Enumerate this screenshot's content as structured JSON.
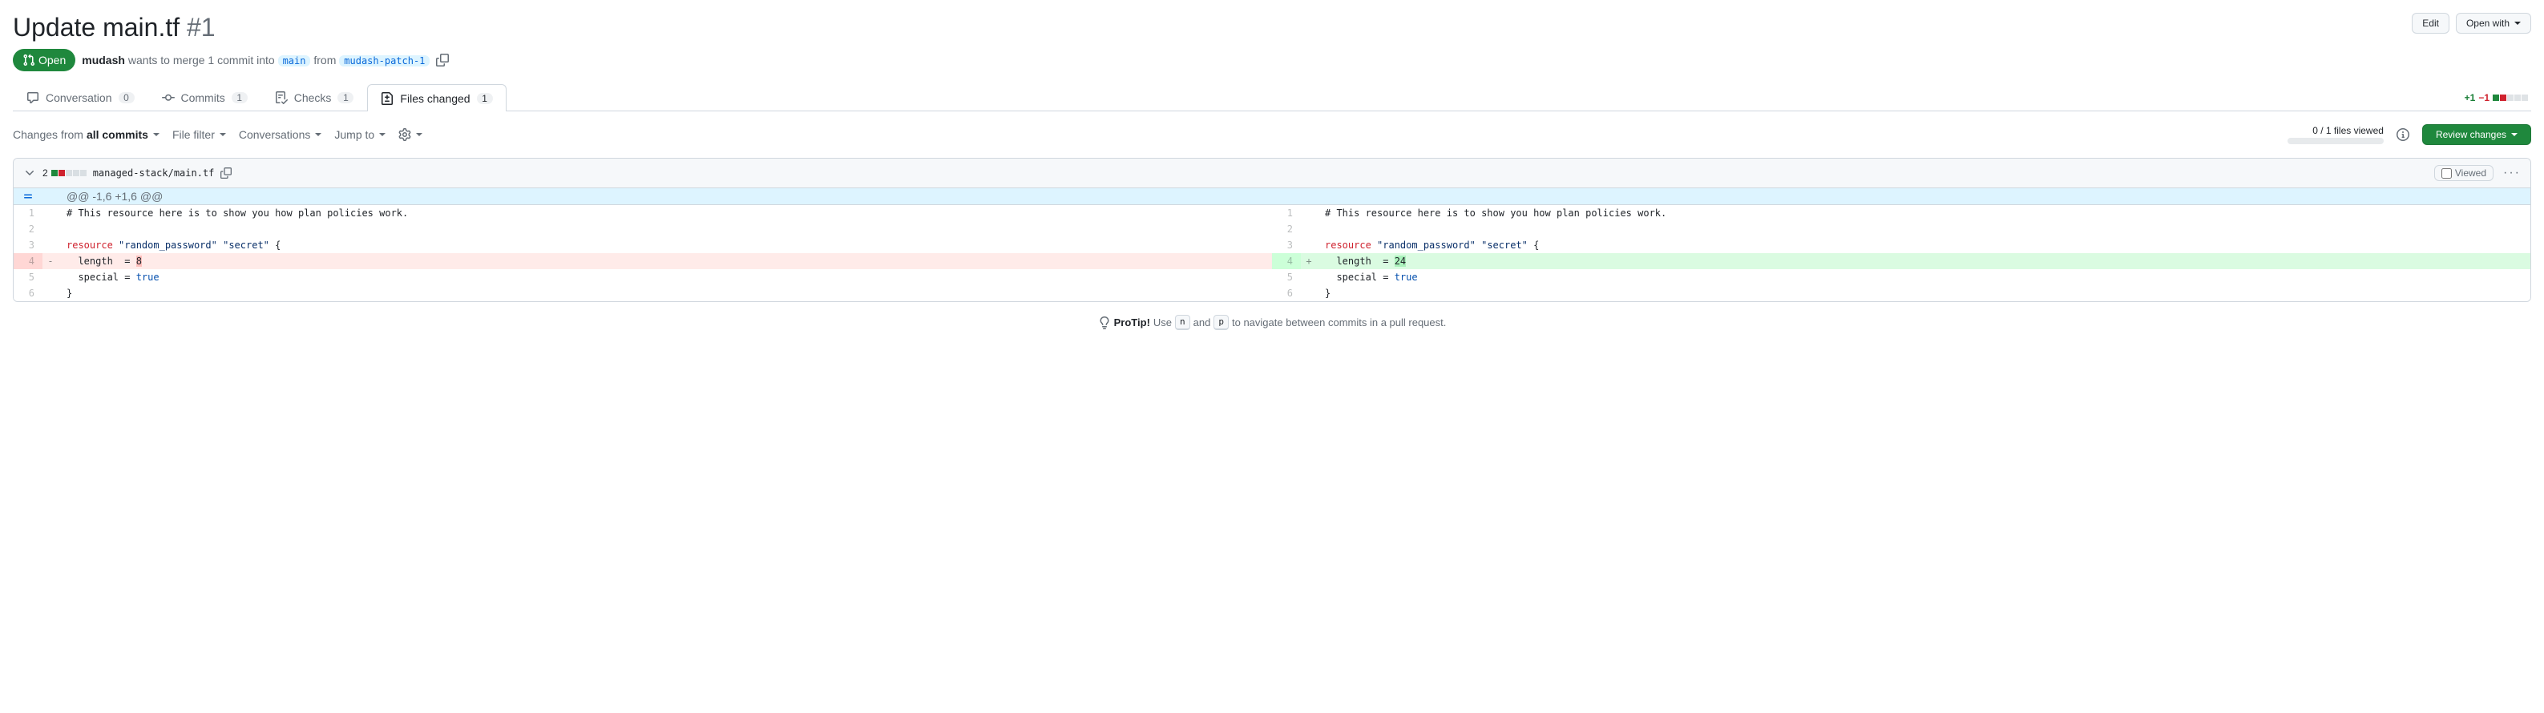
{
  "header": {
    "title": "Update main.tf",
    "number": "#1",
    "edit_btn": "Edit",
    "open_with_btn": "Open with"
  },
  "meta": {
    "state_label": "Open",
    "author": "mudash",
    "wants_text": " wants to merge 1 commit into ",
    "base_branch": "main",
    "from_text": " from ",
    "head_branch": "mudash-patch-1"
  },
  "tabs": {
    "conversation": {
      "label": "Conversation",
      "count": "0"
    },
    "commits": {
      "label": "Commits",
      "count": "1"
    },
    "checks": {
      "label": "Checks",
      "count": "1"
    },
    "files": {
      "label": "Files changed",
      "count": "1"
    }
  },
  "topdiff": {
    "additions": "+1",
    "deletions": "−1"
  },
  "toolbar": {
    "changes_prefix": "Changes from ",
    "changes_value": "all commits",
    "file_filter": "File filter",
    "conversations": "Conversations",
    "jump_to": "Jump to",
    "viewed_text": "0 / 1 files viewed",
    "review_btn": "Review changes"
  },
  "file": {
    "changes": "2",
    "path": "managed-stack/main.tf",
    "viewed_label": "Viewed",
    "hunk": "@@ -1,6 +1,6 @@"
  },
  "left_lines": [
    {
      "n": "1",
      "t": "ctx",
      "code": "# This resource here is to show you how plan policies work."
    },
    {
      "n": "2",
      "t": "ctx",
      "code": ""
    },
    {
      "n": "3",
      "t": "ctx",
      "code": "resource \"random_password\" \"secret\" {",
      "hl": "res"
    },
    {
      "n": "4",
      "t": "del",
      "code": "  length  = 8",
      "val": "8"
    },
    {
      "n": "5",
      "t": "ctx",
      "code": "  special = true",
      "hl": "bool"
    },
    {
      "n": "6",
      "t": "ctx",
      "code": "}"
    }
  ],
  "right_lines": [
    {
      "n": "1",
      "t": "ctx",
      "code": "# This resource here is to show you how plan policies work."
    },
    {
      "n": "2",
      "t": "ctx",
      "code": ""
    },
    {
      "n": "3",
      "t": "ctx",
      "code": "resource \"random_password\" \"secret\" {",
      "hl": "res"
    },
    {
      "n": "4",
      "t": "add",
      "code": "  length  = 24",
      "val": "24"
    },
    {
      "n": "5",
      "t": "ctx",
      "code": "  special = true",
      "hl": "bool"
    },
    {
      "n": "6",
      "t": "ctx",
      "code": "}"
    }
  ],
  "protip": {
    "prefix": "ProTip!",
    "text1": " Use ",
    "key1": "n",
    "text2": " and ",
    "key2": "p",
    "text3": " to navigate between commits in a pull request."
  }
}
